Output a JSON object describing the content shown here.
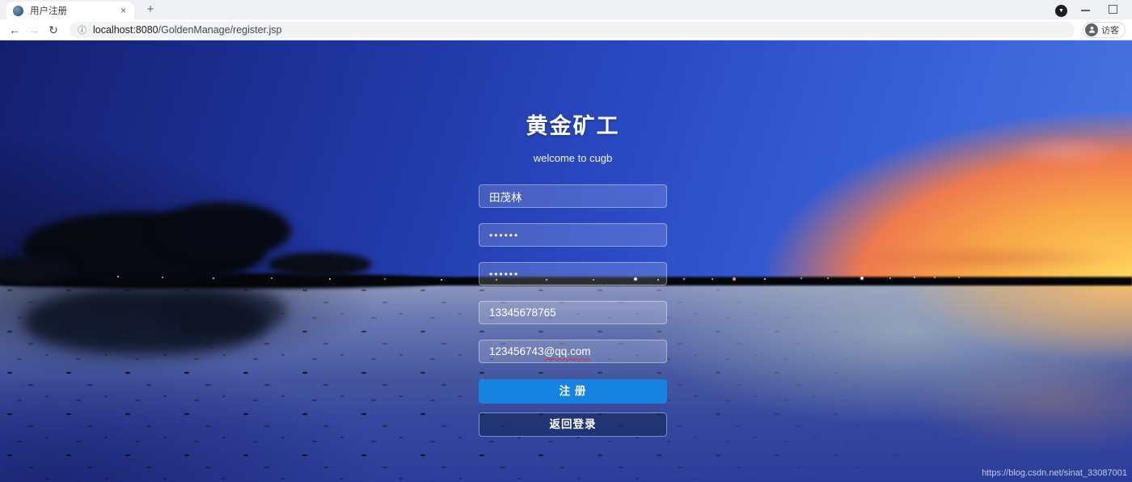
{
  "browser": {
    "tab_title": "用户注册",
    "tab_close": "×",
    "new_tab": "+",
    "url_host": "localhost:8080",
    "url_path": "/GoldenManage/register.jsp",
    "profile_label": "访客"
  },
  "form": {
    "title": "黄金矿工",
    "subtitle": "welcome to cugb",
    "username_value": "田茂林",
    "password_value": "••••••",
    "confirm_value": "••••••",
    "phone_value": "13345678765",
    "email_plain": "123456743",
    "email_flagged": "@qq.com",
    "register_label": "注 册",
    "back_label": "返回登录"
  },
  "watermark": "https://blog.csdn.net/sinat_33087001",
  "colors": {
    "accent_blue": "#1583df",
    "back_button_border": "#7da5e1",
    "spellcheck_red": "#d93025"
  }
}
